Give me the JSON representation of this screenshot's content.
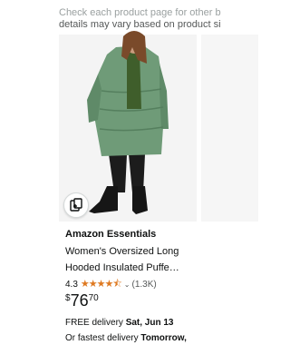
{
  "note": {
    "line1": "Check each product page for other b",
    "line2": "details may vary based on product si"
  },
  "product": {
    "brand": "Amazon Essentials",
    "title": "Women's Oversized Long Hooded Insulated Puffe…",
    "rating_value": "4.3",
    "rating_stars": "★★★★⯪",
    "rating_count": "(1.3K)",
    "price_symbol": "$",
    "price_whole": "76",
    "price_fraction": "70",
    "delivery_prefix": "FREE delivery ",
    "delivery_date": "Sat, Jun 13",
    "fastest_prefix": "Or fastest delivery ",
    "fastest_date": "Tomorrow,",
    "icons": {
      "card": "add-to-card-icon"
    }
  }
}
